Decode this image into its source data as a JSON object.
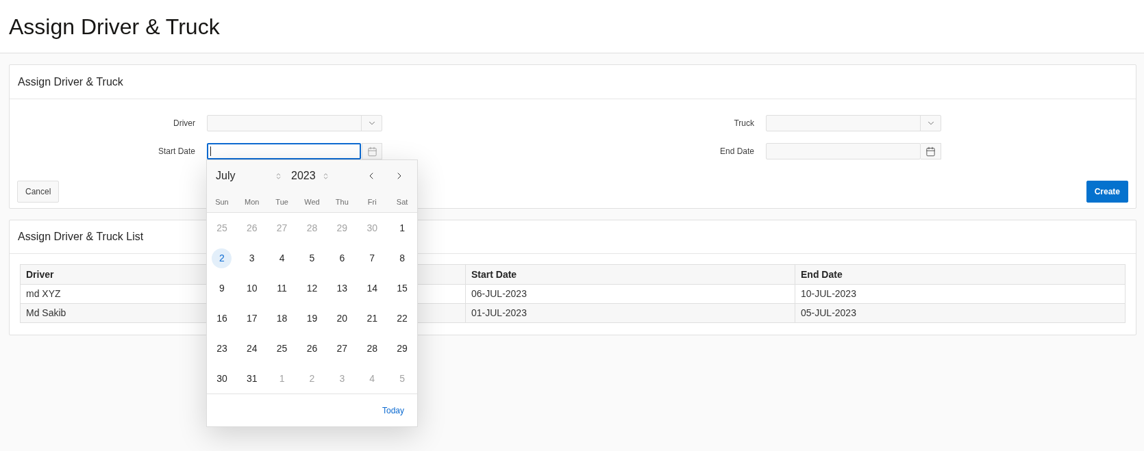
{
  "page": {
    "title": "Assign Driver & Truck"
  },
  "form_region": {
    "title": "Assign Driver & Truck",
    "fields": [
      {
        "label": "Driver",
        "kind": "select",
        "focused": false
      },
      {
        "label": "Truck",
        "kind": "select",
        "focused": false
      },
      {
        "label": "Start Date",
        "kind": "date",
        "focused": true,
        "date_picker": {
          "month": "July",
          "year": "2023",
          "weekdays": [
            "Sun",
            "Mon",
            "Tue",
            "Wed",
            "Thu",
            "Fri",
            "Sat"
          ],
          "weeks": [
            [
              {
                "day": "25",
                "outside_month": true,
                "selected": false
              },
              {
                "day": "26",
                "outside_month": true,
                "selected": false
              },
              {
                "day": "27",
                "outside_month": true,
                "selected": false
              },
              {
                "day": "28",
                "outside_month": true,
                "selected": false
              },
              {
                "day": "29",
                "outside_month": true,
                "selected": false
              },
              {
                "day": "30",
                "outside_month": true,
                "selected": false
              },
              {
                "day": "1",
                "outside_month": false,
                "selected": false
              }
            ],
            [
              {
                "day": "2",
                "outside_month": false,
                "selected": true
              },
              {
                "day": "3",
                "outside_month": false,
                "selected": false
              },
              {
                "day": "4",
                "outside_month": false,
                "selected": false
              },
              {
                "day": "5",
                "outside_month": false,
                "selected": false
              },
              {
                "day": "6",
                "outside_month": false,
                "selected": false
              },
              {
                "day": "7",
                "outside_month": false,
                "selected": false
              },
              {
                "day": "8",
                "outside_month": false,
                "selected": false
              }
            ],
            [
              {
                "day": "9",
                "outside_month": false,
                "selected": false
              },
              {
                "day": "10",
                "outside_month": false,
                "selected": false
              },
              {
                "day": "11",
                "outside_month": false,
                "selected": false
              },
              {
                "day": "12",
                "outside_month": false,
                "selected": false
              },
              {
                "day": "13",
                "outside_month": false,
                "selected": false
              },
              {
                "day": "14",
                "outside_month": false,
                "selected": false
              },
              {
                "day": "15",
                "outside_month": false,
                "selected": false
              }
            ],
            [
              {
                "day": "16",
                "outside_month": false,
                "selected": false
              },
              {
                "day": "17",
                "outside_month": false,
                "selected": false
              },
              {
                "day": "18",
                "outside_month": false,
                "selected": false
              },
              {
                "day": "19",
                "outside_month": false,
                "selected": false
              },
              {
                "day": "20",
                "outside_month": false,
                "selected": false
              },
              {
                "day": "21",
                "outside_month": false,
                "selected": false
              },
              {
                "day": "22",
                "outside_month": false,
                "selected": false
              }
            ],
            [
              {
                "day": "23",
                "outside_month": false,
                "selected": false
              },
              {
                "day": "24",
                "outside_month": false,
                "selected": false
              },
              {
                "day": "25",
                "outside_month": false,
                "selected": false
              },
              {
                "day": "26",
                "outside_month": false,
                "selected": false
              },
              {
                "day": "27",
                "outside_month": false,
                "selected": false
              },
              {
                "day": "28",
                "outside_month": false,
                "selected": false
              },
              {
                "day": "29",
                "outside_month": false,
                "selected": false
              }
            ],
            [
              {
                "day": "30",
                "outside_month": false,
                "selected": false
              },
              {
                "day": "31",
                "outside_month": false,
                "selected": false
              },
              {
                "day": "1",
                "outside_month": true,
                "selected": false
              },
              {
                "day": "2",
                "outside_month": true,
                "selected": false
              },
              {
                "day": "3",
                "outside_month": true,
                "selected": false
              },
              {
                "day": "4",
                "outside_month": true,
                "selected": false
              },
              {
                "day": "5",
                "outside_month": true,
                "selected": false
              }
            ]
          ],
          "today_button": "Today"
        }
      },
      {
        "label": "End Date",
        "kind": "date",
        "focused": false
      }
    ],
    "buttons": [
      {
        "label": "Cancel",
        "kind": "secondary"
      },
      {
        "label": "Create",
        "kind": "primary"
      }
    ]
  },
  "list_region": {
    "title": "Assign Driver & Truck List",
    "table": {
      "columns": [
        "Driver",
        "Start Date",
        "End Date"
      ],
      "rows": [
        [
          "md XYZ",
          "06-JUL-2023",
          "10-JUL-2023"
        ],
        [
          "Md Sakib",
          "01-JUL-2023",
          "05-JUL-2023"
        ]
      ]
    }
  }
}
